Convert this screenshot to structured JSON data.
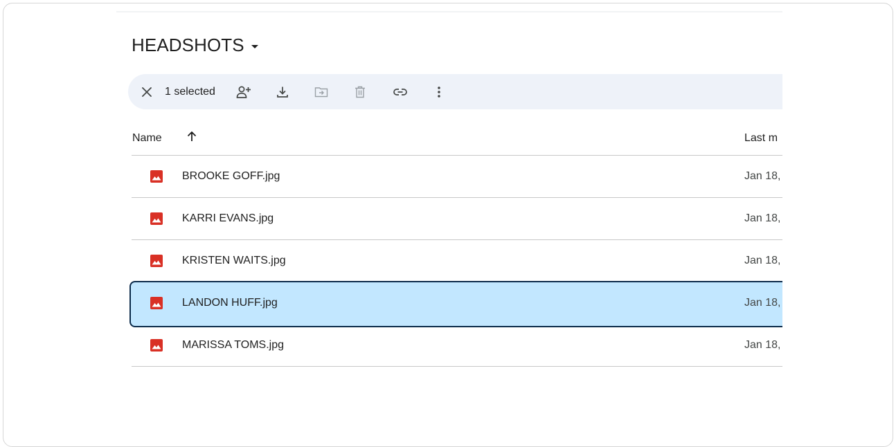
{
  "folder": {
    "title": "HEADSHOTS"
  },
  "toolbar": {
    "selected_count": "1 selected",
    "icons": [
      "close-icon",
      "share-icon",
      "download-icon",
      "move-icon",
      "trash-icon",
      "link-icon",
      "more-vert-icon"
    ]
  },
  "columns": {
    "name": "Name",
    "last_modified": "Last m"
  },
  "files": [
    {
      "name": "BROOKE GOFF.jpg",
      "date": "Jan 18,",
      "selected": false
    },
    {
      "name": "KARRI EVANS.jpg",
      "date": "Jan 18,",
      "selected": false
    },
    {
      "name": "KRISTEN WAITS.jpg",
      "date": "Jan 18,",
      "selected": false
    },
    {
      "name": "LANDON HUFF.jpg",
      "date": "Jan 18,",
      "selected": true
    },
    {
      "name": "MARISSA TOMS.jpg",
      "date": "Jan 18,",
      "selected": false
    }
  ],
  "colors": {
    "image_icon": "#d93025",
    "selected_row": "#c2e7ff",
    "selected_border": "#0b2a4a",
    "toolbar_bg": "#eef2f9"
  }
}
